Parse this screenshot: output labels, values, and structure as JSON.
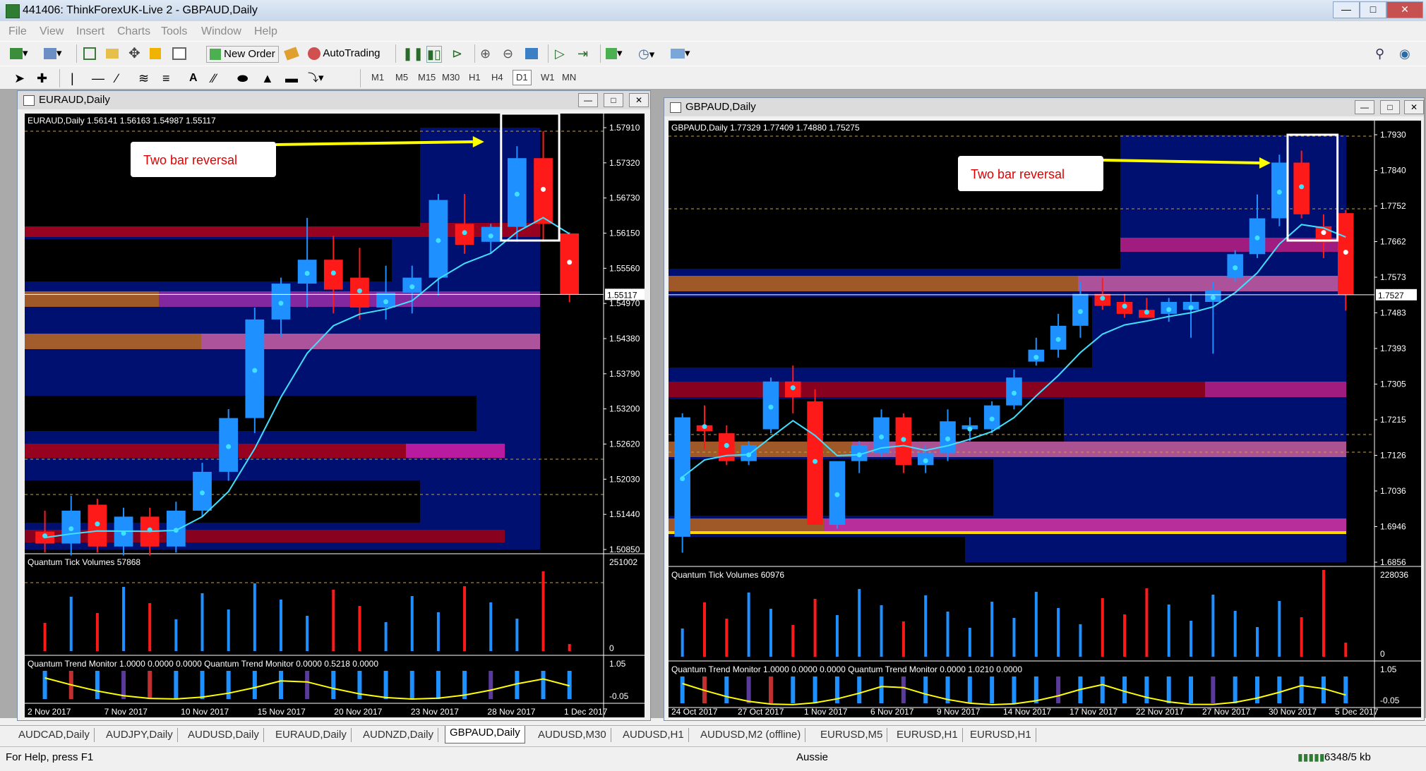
{
  "window": {
    "title": "441406: ThinkForexUK-Live 2 - GBPAUD,Daily"
  },
  "menu": [
    "File",
    "View",
    "Insert",
    "Charts",
    "Tools",
    "Window",
    "Help"
  ],
  "toolbar": {
    "new_order": "New Order",
    "autotrading": "AutoTrading"
  },
  "timeframes": [
    "M1",
    "M5",
    "M15",
    "M30",
    "H1",
    "H4",
    "D1",
    "W1",
    "MN"
  ],
  "active_timeframe": "D1",
  "left_chart": {
    "window_title": "EURAUD,Daily",
    "header": "EURAUD,Daily  1.56141 1.56163 1.54987 1.55117",
    "annotation": "Two bar reversal",
    "price_labels": [
      "1.57910",
      "1.57320",
      "1.56730",
      "1.56150",
      "1.55560",
      "1.54970",
      "1.54380",
      "1.53790",
      "1.53200",
      "1.52620",
      "1.52030",
      "1.51440",
      "1.50850"
    ],
    "current_price": "1.55117",
    "volume_title": "Quantum Tick Volumes 57868",
    "volume_scale_top": "251002",
    "volume_scale_bottom": "0",
    "trend_title": "Quantum Trend Monitor 1.0000 0.0000 0.0000  Quantum Trend Monitor 0.0000 0.5218 0.0000",
    "trend_scale_top": "1.05",
    "trend_scale_bottom": "-0.05",
    "dates": [
      "2 Nov 2017",
      "7 Nov 2017",
      "10 Nov 2017",
      "15 Nov 2017",
      "20 Nov 2017",
      "23 Nov 2017",
      "28 Nov 2017",
      "1 Dec 2017"
    ]
  },
  "right_chart": {
    "window_title": "GBPAUD,Daily",
    "header": "GBPAUD,Daily  1.77329 1.77409 1.74880 1.75275",
    "annotation": "Two bar reversal",
    "price_labels": [
      "1.7930",
      "1.7840",
      "1.7752",
      "1.7662",
      "1.7573",
      "1.7483",
      "1.7393",
      "1.7305",
      "1.7215",
      "1.7126",
      "1.7036",
      "1.6946",
      "1.6856"
    ],
    "current_price": "1.7527",
    "volume_title": "Quantum Tick Volumes 60976",
    "volume_scale_top": "228036",
    "volume_scale_bottom": "0",
    "trend_title": "Quantum Trend Monitor 1.0000 0.0000 0.0000  Quantum Trend Monitor 0.0000 1.0210 0.0000",
    "trend_scale_top": "1.05",
    "trend_scale_bottom": "-0.05",
    "dates": [
      "24 Oct 2017",
      "27 Oct 2017",
      "1 Nov 2017",
      "6 Nov 2017",
      "9 Nov 2017",
      "14 Nov 2017",
      "17 Nov 2017",
      "22 Nov 2017",
      "27 Nov 2017",
      "30 Nov 2017",
      "5 Dec 2017"
    ]
  },
  "tabs": [
    "AUDCAD,Daily",
    "AUDJPY,Daily",
    "AUDUSD,Daily",
    "EURAUD,Daily",
    "AUDNZD,Daily",
    "GBPAUD,Daily",
    "AUDUSD,M30",
    "AUDUSD,H1",
    "AUDUSD,M2 (offline)",
    "EURUSD,M5",
    "EURUSD,H1",
    "EURUSD,H1"
  ],
  "active_tab": "GBPAUD,Daily",
  "status": {
    "help": "For Help, press F1",
    "profile": "Aussie",
    "traffic": "6348/5 kb"
  },
  "colors": {
    "bull": "#1e90ff",
    "bear": "#ff1a1a",
    "ma": "#40e0ff",
    "arrow": "#ffff00"
  },
  "left_candles": [
    {
      "o": 1.5115,
      "h": 1.515,
      "l": 1.508,
      "c": 1.5095
    },
    {
      "o": 1.5095,
      "h": 1.5175,
      "l": 1.5075,
      "c": 1.515
    },
    {
      "o": 1.516,
      "h": 1.517,
      "l": 1.508,
      "c": 1.509
    },
    {
      "o": 1.509,
      "h": 1.5155,
      "l": 1.5075,
      "c": 1.514
    },
    {
      "o": 1.514,
      "h": 1.5155,
      "l": 1.5075,
      "c": 1.509
    },
    {
      "o": 1.509,
      "h": 1.5165,
      "l": 1.508,
      "c": 1.515
    },
    {
      "o": 1.515,
      "h": 1.523,
      "l": 1.514,
      "c": 1.5215
    },
    {
      "o": 1.5215,
      "h": 1.532,
      "l": 1.52,
      "c": 1.5305
    },
    {
      "o": 1.5305,
      "h": 1.549,
      "l": 1.528,
      "c": 1.547
    },
    {
      "o": 1.547,
      "h": 1.554,
      "l": 1.544,
      "c": 1.553
    },
    {
      "o": 1.553,
      "h": 1.564,
      "l": 1.549,
      "c": 1.557
    },
    {
      "o": 1.557,
      "h": 1.561,
      "l": 1.548,
      "c": 1.552
    },
    {
      "o": 1.554,
      "h": 1.559,
      "l": 1.547,
      "c": 1.549
    },
    {
      "o": 1.549,
      "h": 1.556,
      "l": 1.547,
      "c": 1.5515
    },
    {
      "o": 1.5515,
      "h": 1.556,
      "l": 1.548,
      "c": 1.554
    },
    {
      "o": 1.554,
      "h": 1.568,
      "l": 1.551,
      "c": 1.567
    },
    {
      "o": 1.563,
      "h": 1.568,
      "l": 1.558,
      "c": 1.5595
    },
    {
      "o": 1.56,
      "h": 1.563,
      "l": 1.558,
      "c": 1.5625
    },
    {
      "o": 1.5625,
      "h": 1.576,
      "l": 1.56,
      "c": 1.574
    },
    {
      "o": 1.574,
      "h": 1.5785,
      "l": 1.56,
      "c": 1.563
    },
    {
      "o": 1.5614,
      "h": 1.5616,
      "l": 1.5499,
      "c": 1.5512
    }
  ],
  "right_candles": [
    {
      "o": 1.692,
      "h": 1.723,
      "l": 1.688,
      "c": 1.722
    },
    {
      "o": 1.72,
      "h": 1.725,
      "l": 1.714,
      "c": 1.7185
    },
    {
      "o": 1.718,
      "h": 1.72,
      "l": 1.71,
      "c": 1.711
    },
    {
      "o": 1.711,
      "h": 1.716,
      "l": 1.71,
      "c": 1.715
    },
    {
      "o": 1.719,
      "h": 1.732,
      "l": 1.718,
      "c": 1.731
    },
    {
      "o": 1.731,
      "h": 1.735,
      "l": 1.723,
      "c": 1.727
    },
    {
      "o": 1.726,
      "h": 1.729,
      "l": 1.696,
      "c": 1.695
    },
    {
      "o": 1.695,
      "h": 1.71,
      "l": 1.694,
      "c": 1.711
    },
    {
      "o": 1.711,
      "h": 1.716,
      "l": 1.708,
      "c": 1.715
    },
    {
      "o": 1.713,
      "h": 1.724,
      "l": 1.712,
      "c": 1.722
    },
    {
      "o": 1.722,
      "h": 1.723,
      "l": 1.708,
      "c": 1.71
    },
    {
      "o": 1.71,
      "h": 1.715,
      "l": 1.708,
      "c": 1.713
    },
    {
      "o": 1.713,
      "h": 1.724,
      "l": 1.711,
      "c": 1.721
    },
    {
      "o": 1.719,
      "h": 1.722,
      "l": 1.716,
      "c": 1.72
    },
    {
      "o": 1.719,
      "h": 1.726,
      "l": 1.718,
      "c": 1.725
    },
    {
      "o": 1.725,
      "h": 1.734,
      "l": 1.724,
      "c": 1.732
    },
    {
      "o": 1.736,
      "h": 1.742,
      "l": 1.735,
      "c": 1.739
    },
    {
      "o": 1.739,
      "h": 1.748,
      "l": 1.737,
      "c": 1.745
    },
    {
      "o": 1.745,
      "h": 1.756,
      "l": 1.742,
      "c": 1.753
    },
    {
      "o": 1.753,
      "h": 1.757,
      "l": 1.749,
      "c": 1.75
    },
    {
      "o": 1.751,
      "h": 1.753,
      "l": 1.747,
      "c": 1.748
    },
    {
      "o": 1.749,
      "h": 1.752,
      "l": 1.747,
      "c": 1.747
    },
    {
      "o": 1.748,
      "h": 1.752,
      "l": 1.746,
      "c": 1.751
    },
    {
      "o": 1.749,
      "h": 1.753,
      "l": 1.742,
      "c": 1.751
    },
    {
      "o": 1.751,
      "h": 1.756,
      "l": 1.738,
      "c": 1.754
    },
    {
      "o": 1.757,
      "h": 1.764,
      "l": 1.756,
      "c": 1.763
    },
    {
      "o": 1.763,
      "h": 1.778,
      "l": 1.762,
      "c": 1.772
    },
    {
      "o": 1.772,
      "h": 1.788,
      "l": 1.77,
      "c": 1.786
    },
    {
      "o": 1.786,
      "h": 1.789,
      "l": 1.772,
      "c": 1.773
    },
    {
      "o": 1.77,
      "h": 1.773,
      "l": 1.762,
      "c": 1.766
    },
    {
      "o": 1.7733,
      "h": 1.7741,
      "l": 1.7488,
      "c": 1.7528
    }
  ]
}
